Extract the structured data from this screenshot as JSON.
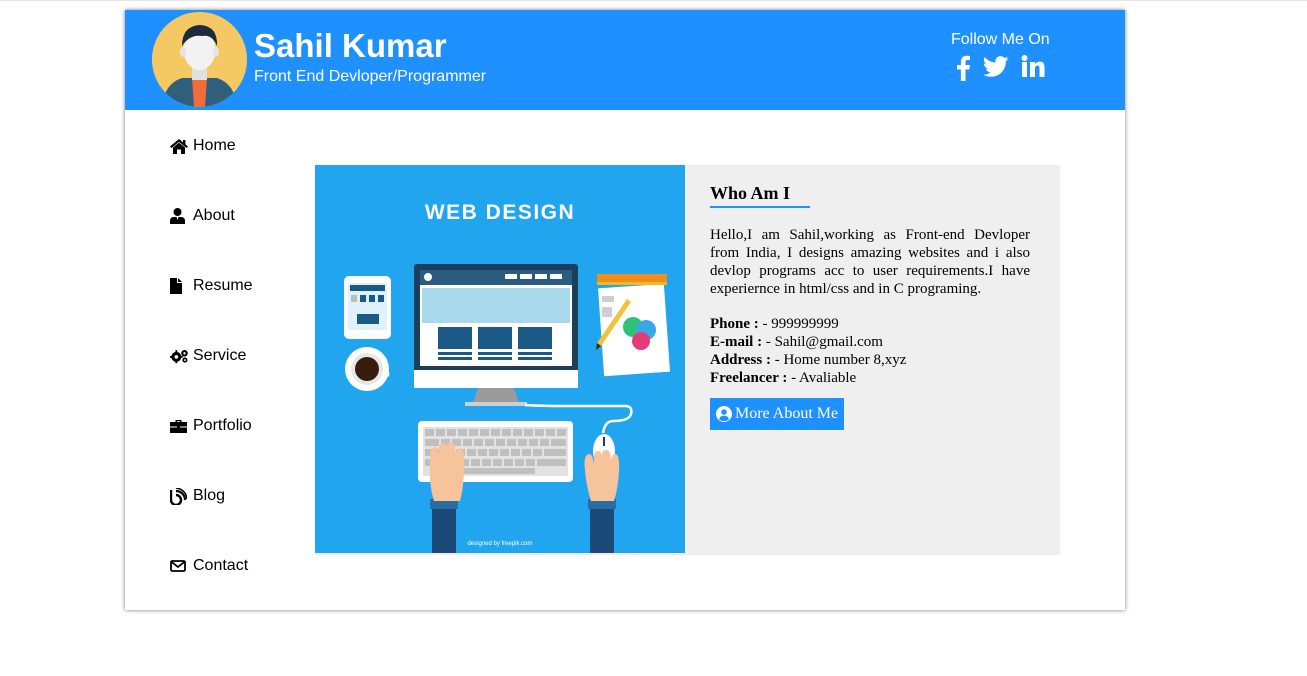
{
  "profile": {
    "name": "Sahil Kumar",
    "role": "Front End Devloper/Programmer"
  },
  "social": {
    "heading": "Follow Me On",
    "links": [
      "facebook-icon",
      "twitter-icon",
      "linkedin-icon"
    ]
  },
  "nav": {
    "items": [
      {
        "label": "Home",
        "icon": "home-icon"
      },
      {
        "label": "About",
        "icon": "user-icon"
      },
      {
        "label": "Resume",
        "icon": "file-icon"
      },
      {
        "label": "Service",
        "icon": "gears-icon"
      },
      {
        "label": "Portfolio",
        "icon": "briefcase-icon"
      },
      {
        "label": "Blog",
        "icon": "blog-icon"
      },
      {
        "label": "Contact",
        "icon": "envelope-icon"
      }
    ]
  },
  "illustration": {
    "title": "WEB DESIGN",
    "credit": "designed by freepik.com"
  },
  "about": {
    "heading": "Who Am I",
    "bio": "Hello,I am Sahil,working as Front-end Devloper from India, I designs amazing websites and i also devlop programs acc to user requirements.I have experiernce in html/css and in C programing.",
    "details": [
      {
        "label": "Phone :",
        "value": " - 999999999"
      },
      {
        "label": "E-mail :",
        "value": " - Sahil@gmail.com"
      },
      {
        "label": "Address :",
        "value": " - Home number 8,xyz"
      },
      {
        "label": "Freelancer :",
        "value": " - Avaliable"
      }
    ],
    "button_label": "More About Me"
  },
  "colors": {
    "header": "#1e90ff",
    "content_bg": "#efefef",
    "illustration_bg": "#21a5ef",
    "button": "#1e90ff"
  }
}
